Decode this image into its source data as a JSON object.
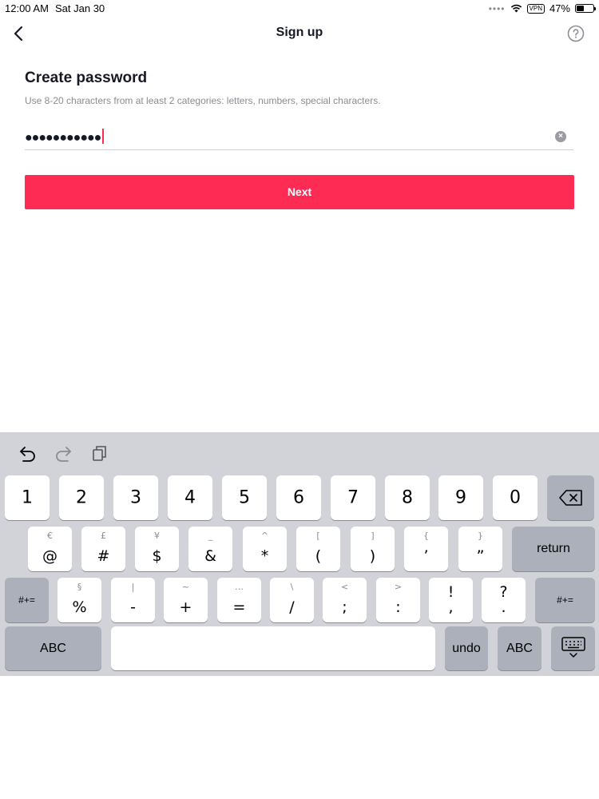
{
  "status_bar": {
    "time": "12:00 AM",
    "date": "Sat Jan 30",
    "dots": "••••",
    "vpn": "VPN",
    "battery": "47%",
    "battery_level": 0.47
  },
  "nav": {
    "title": "Sign up",
    "back_icon": "chevron-left-icon",
    "help_icon": "question-circle-icon"
  },
  "form": {
    "heading": "Create password",
    "hint": "Use 8-20 characters from at least 2 categories: letters, numbers, special characters.",
    "password_masked": "●●●●●●●●●●●",
    "clear_icon": "×",
    "next_label": "Next"
  },
  "colors": {
    "accent": "#fe2c55",
    "keyboard_bg": "#d1d3d9",
    "dark_key": "#abb0ba"
  },
  "keyboard": {
    "toolbar": [
      "undo-icon",
      "redo-icon",
      "paste-icon"
    ],
    "row1": [
      "1",
      "2",
      "3",
      "4",
      "5",
      "6",
      "7",
      "8",
      "9",
      "0"
    ],
    "row2": [
      {
        "alt": "€",
        "main": "@"
      },
      {
        "alt": "£",
        "main": "#"
      },
      {
        "alt": "¥",
        "main": "$"
      },
      {
        "alt": "_",
        "main": "&"
      },
      {
        "alt": "^",
        "main": "*"
      },
      {
        "alt": "[",
        "main": "("
      },
      {
        "alt": "]",
        "main": ")"
      },
      {
        "alt": "{",
        "main": "’"
      },
      {
        "alt": "}",
        "main": "”"
      }
    ],
    "row3": [
      {
        "alt": "§",
        "main": "%"
      },
      {
        "alt": "|",
        "main": "-"
      },
      {
        "alt": "~",
        "main": "+"
      },
      {
        "alt": "…",
        "main": "="
      },
      {
        "alt": "\\",
        "main": "/"
      },
      {
        "alt": "<",
        "main": ";"
      },
      {
        "alt": ">",
        "main": ":"
      },
      {
        "alt": "!",
        "main": ","
      },
      {
        "alt": "?",
        "main": "."
      }
    ],
    "return_label": "return",
    "symbols_label": "#+=",
    "abc_label": "ABC",
    "undo_label": "undo"
  }
}
